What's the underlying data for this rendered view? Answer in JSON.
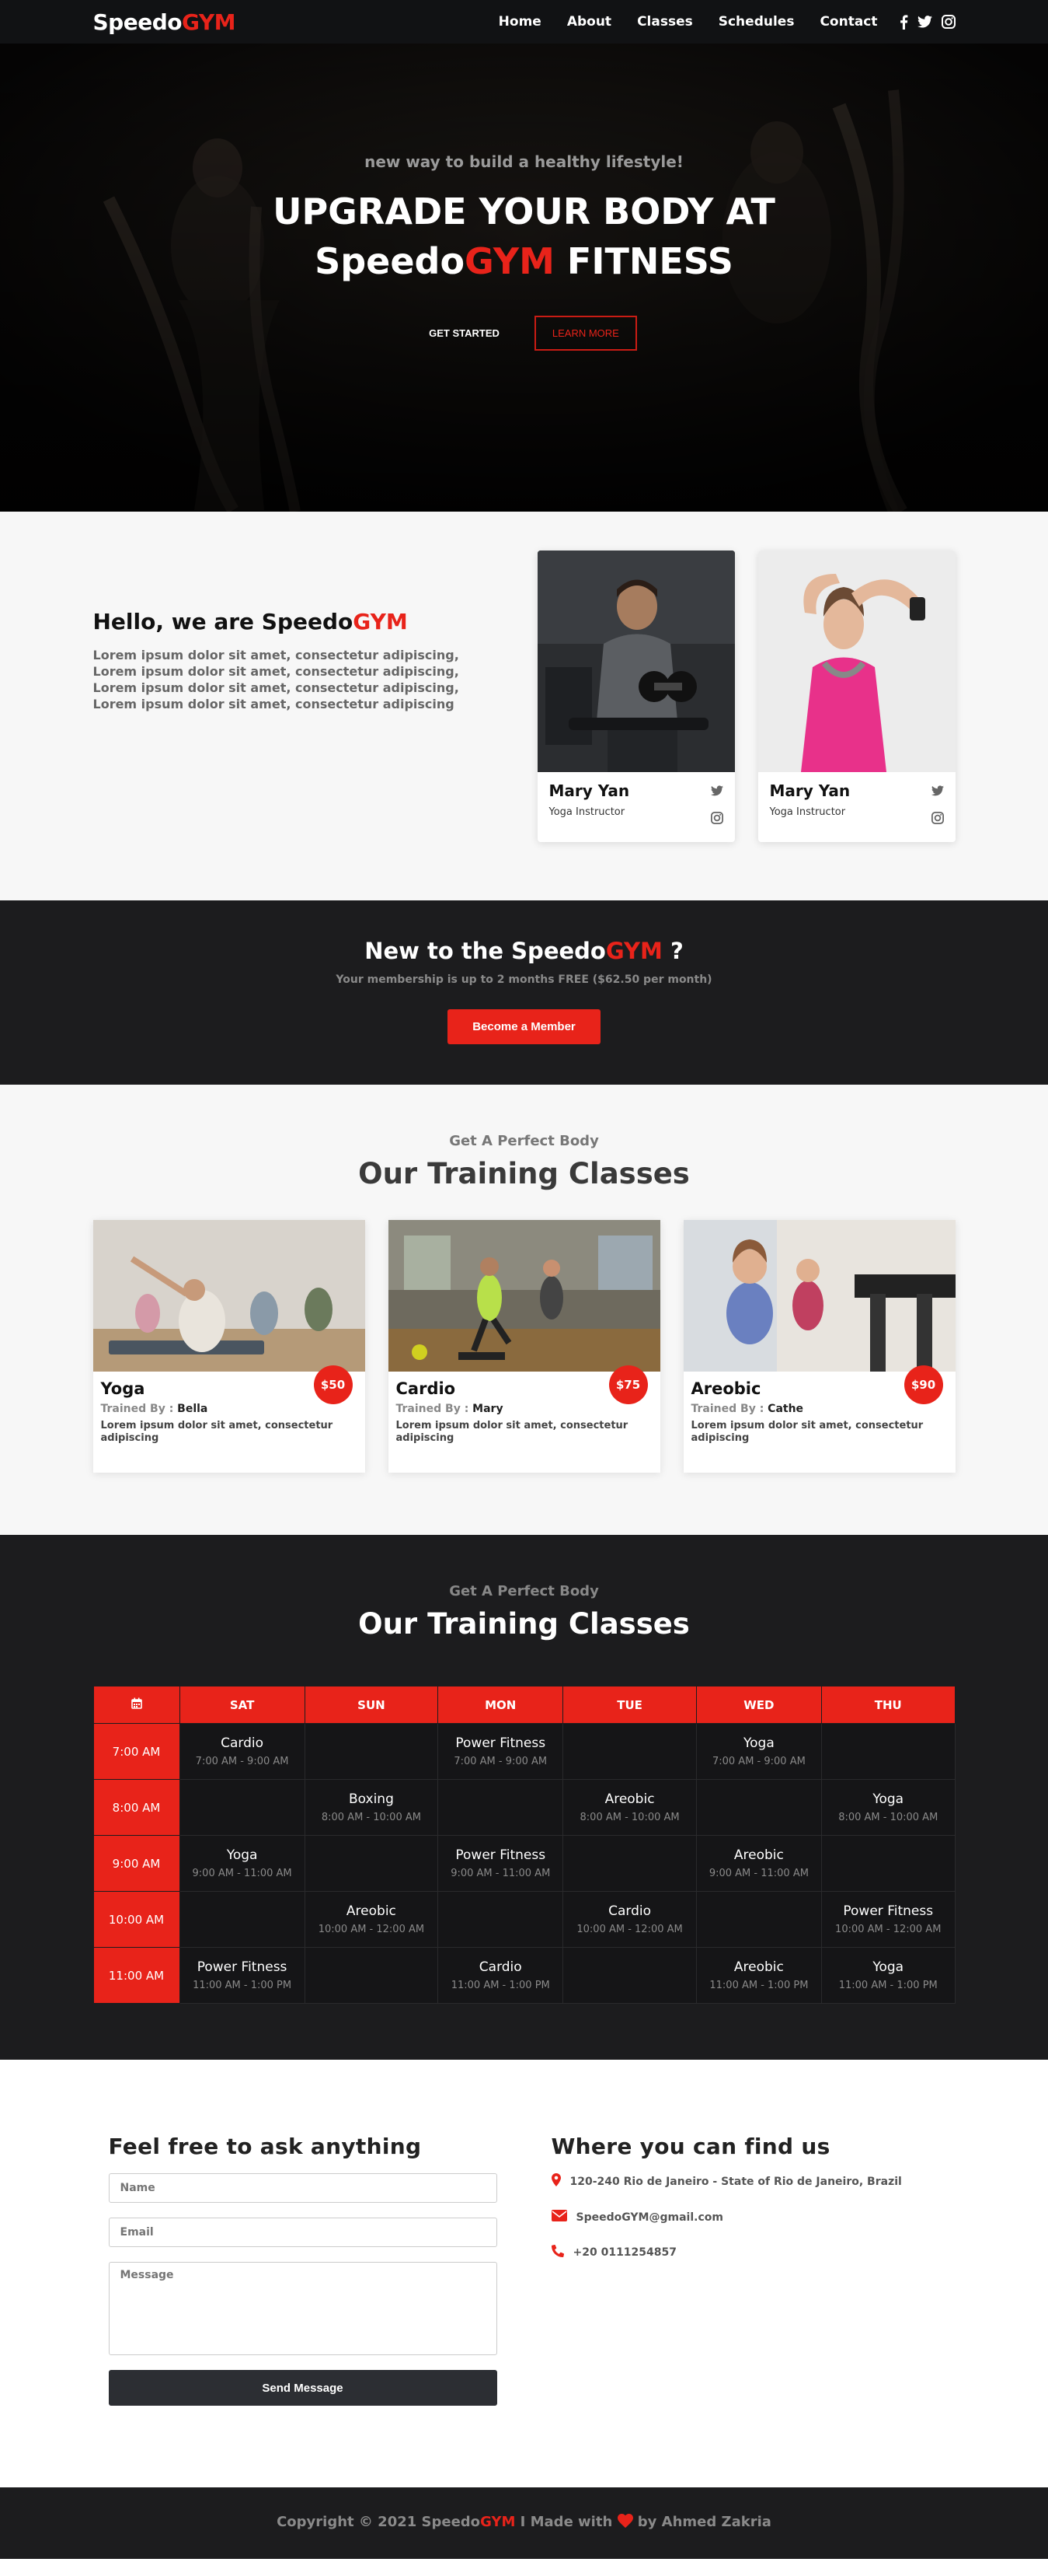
{
  "brand": {
    "name_part1": "Speedo",
    "name_part2": "GYM"
  },
  "nav": {
    "items": [
      "Home",
      "About",
      "Classes",
      "Schedules",
      "Contact"
    ],
    "social_icons": [
      "facebook-icon",
      "twitter-icon",
      "instagram-icon"
    ]
  },
  "hero": {
    "subtitle": "new way to build a healthy lifestyle!",
    "title_line1": "UPGRADE YOUR BODY AT",
    "title_line2_a": "Speedo",
    "title_line2_b": "GYM",
    "title_line2_c": "FITNESS",
    "btn_start": "GET STARTED",
    "btn_learn": "LEARN MORE"
  },
  "about": {
    "heading_a": "Hello, we are Speedo",
    "heading_b": "GYM",
    "body": "Lorem ipsum dolor sit amet, consectetur adipiscing, Lorem ipsum dolor sit amet, consectetur adipiscing, Lorem ipsum dolor sit amet, consectetur adipiscing, Lorem ipsum dolor sit amet, consectetur adipiscing",
    "trainers": [
      {
        "name": "Mary Yan",
        "role": "Yoga Instructor"
      },
      {
        "name": "Mary Yan",
        "role": "Yoga Instructor"
      }
    ]
  },
  "member": {
    "heading_a": "New to the Speedo",
    "heading_b": "GYM",
    "heading_c": " ?",
    "sub": "Your membership is up to 2 months FREE ($62.50 per month)",
    "button": "Become a Member"
  },
  "classes": {
    "sub": "Get A Perfect Body",
    "title": "Our Training Classes",
    "trained_by_label": "Trained By :",
    "items": [
      {
        "name": "Yoga",
        "trainer": "Bella",
        "price": "$50",
        "desc": "Lorem ipsum dolor sit amet, consectetur adipiscing"
      },
      {
        "name": "Cardio",
        "trainer": "Mary",
        "price": "$75",
        "desc": "Lorem ipsum dolor sit amet, consectetur adipiscing"
      },
      {
        "name": "Areobic",
        "trainer": "Cathe",
        "price": "$90",
        "desc": "Lorem ipsum dolor sit amet, consectetur adipiscing"
      }
    ]
  },
  "schedule": {
    "sub": "Get A Perfect Body",
    "title": "Our Training Classes",
    "days": [
      "SAT",
      "SUN",
      "MON",
      "TUE",
      "WED",
      "THU"
    ],
    "rows": [
      {
        "time": "7:00 AM",
        "cells": [
          {
            "t": "Cardio",
            "h": "7:00 AM - 9:00 AM"
          },
          null,
          {
            "t": "Power Fitness",
            "h": "7:00 AM - 9:00 AM"
          },
          null,
          {
            "t": "Yoga",
            "h": "7:00 AM - 9:00 AM"
          },
          null
        ]
      },
      {
        "time": "8:00 AM",
        "cells": [
          null,
          {
            "t": "Boxing",
            "h": "8:00 AM - 10:00 AM"
          },
          null,
          {
            "t": "Areobic",
            "h": "8:00 AM - 10:00 AM"
          },
          null,
          {
            "t": "Yoga",
            "h": "8:00 AM - 10:00 AM"
          }
        ]
      },
      {
        "time": "9:00 AM",
        "cells": [
          {
            "t": "Yoga",
            "h": "9:00 AM - 11:00 AM"
          },
          null,
          {
            "t": "Power Fitness",
            "h": "9:00 AM - 11:00 AM"
          },
          null,
          {
            "t": "Areobic",
            "h": "9:00 AM - 11:00 AM"
          },
          null
        ]
      },
      {
        "time": "10:00 AM",
        "cells": [
          null,
          {
            "t": "Areobic",
            "h": "10:00 AM - 12:00 AM"
          },
          null,
          {
            "t": "Cardio",
            "h": "10:00 AM - 12:00 AM"
          },
          null,
          {
            "t": "Power Fitness",
            "h": "10:00 AM - 12:00 AM"
          }
        ]
      },
      {
        "time": "11:00 AM",
        "cells": [
          {
            "t": "Power Fitness",
            "h": "11:00 AM - 1:00 PM"
          },
          null,
          {
            "t": "Cardio",
            "h": "11:00 AM - 1:00 PM"
          },
          null,
          {
            "t": "Areobic",
            "h": "11:00 AM - 1:00 PM"
          },
          {
            "t": "Yoga",
            "h": "11:00 AM - 1:00 PM"
          }
        ]
      }
    ]
  },
  "contact": {
    "form_title": "Feel free to ask anything",
    "name_placeholder": "Name",
    "email_placeholder": "Email",
    "message_placeholder": "Message",
    "send": "Send Message",
    "find_title": "Where you can find us",
    "address": "120-240 Rio de Janeiro - State of Rio de Janeiro, Brazil",
    "email": "SpeedoGYM@gmail.com",
    "phone": "+20 0111254857"
  },
  "footer": {
    "text_a": "Copyright © 2021 Speedo",
    "text_b": "GYM",
    "text_c": " I Made with ",
    "text_d": " by Ahmed Zakria"
  },
  "colors": {
    "accent": "#e8231a",
    "dark": "#1c1c1e",
    "nav": "#111214"
  }
}
